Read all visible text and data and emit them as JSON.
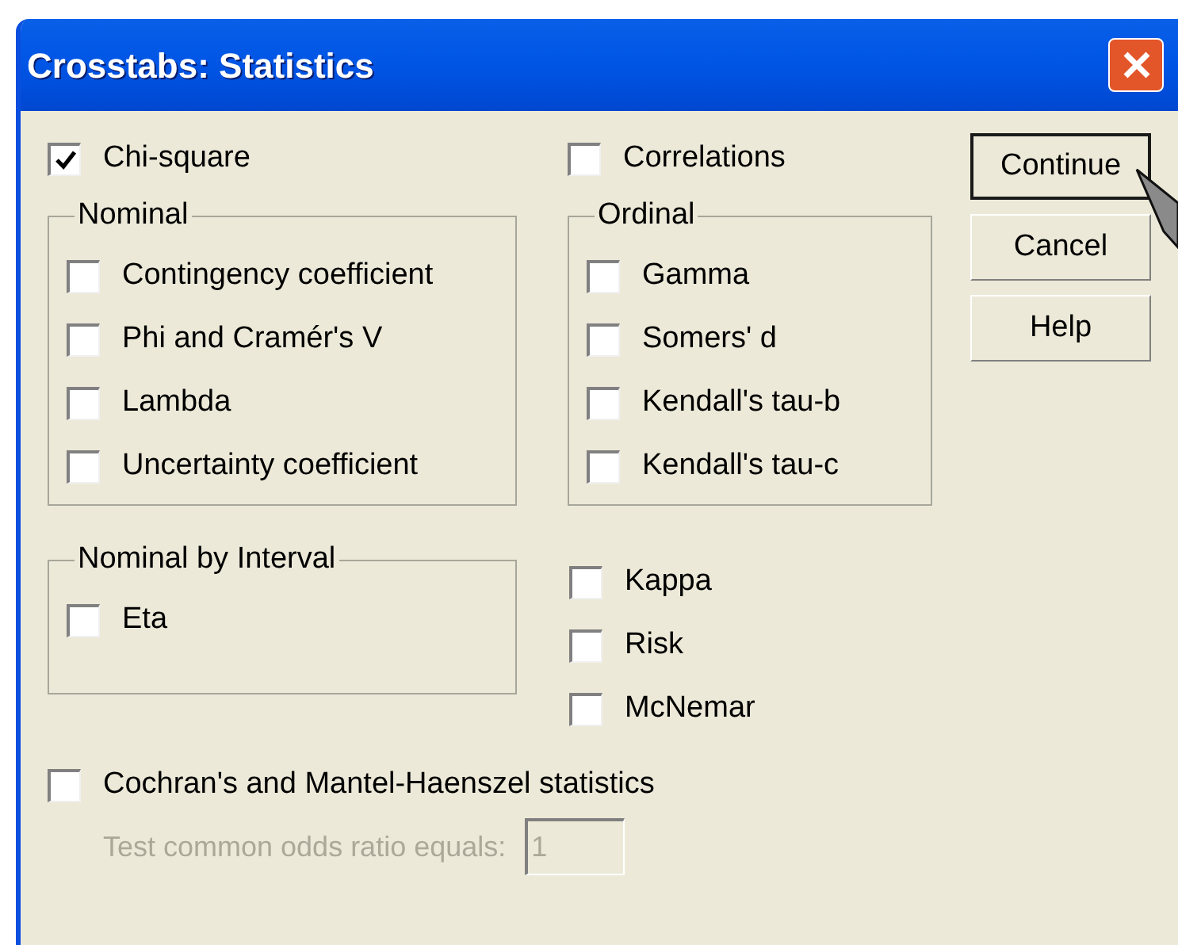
{
  "window": {
    "title": "Crosstabs: Statistics"
  },
  "chi_square": {
    "label": "Chi-square",
    "checked": true
  },
  "correlations": {
    "label": "Correlations",
    "checked": false
  },
  "nominal": {
    "title": "Nominal",
    "options": [
      {
        "label": "Contingency coefficient",
        "checked": false
      },
      {
        "label": "Phi and Cramér's V",
        "checked": false
      },
      {
        "label": "Lambda",
        "checked": false
      },
      {
        "label": "Uncertainty coefficient",
        "checked": false
      }
    ]
  },
  "ordinal": {
    "title": "Ordinal",
    "options": [
      {
        "label": "Gamma",
        "checked": false
      },
      {
        "label": "Somers' d",
        "checked": false
      },
      {
        "label": "Kendall's tau-b",
        "checked": false
      },
      {
        "label": "Kendall's tau-c",
        "checked": false
      }
    ]
  },
  "nominal_by_interval": {
    "title": "Nominal by Interval",
    "options": [
      {
        "label": "Eta",
        "checked": false
      }
    ]
  },
  "other_options": [
    {
      "label": "Kappa",
      "checked": false
    },
    {
      "label": "Risk",
      "checked": false
    },
    {
      "label": "McNemar",
      "checked": false
    }
  ],
  "cochran": {
    "label": "Cochran's and Mantel-Haenszel statistics",
    "checked": false
  },
  "odds_ratio": {
    "label": "Test common odds ratio equals:",
    "value": "1",
    "disabled": true
  },
  "buttons": [
    {
      "label": "Continue",
      "default": true
    },
    {
      "label": "Cancel",
      "default": false
    },
    {
      "label": "Help",
      "default": false
    }
  ]
}
